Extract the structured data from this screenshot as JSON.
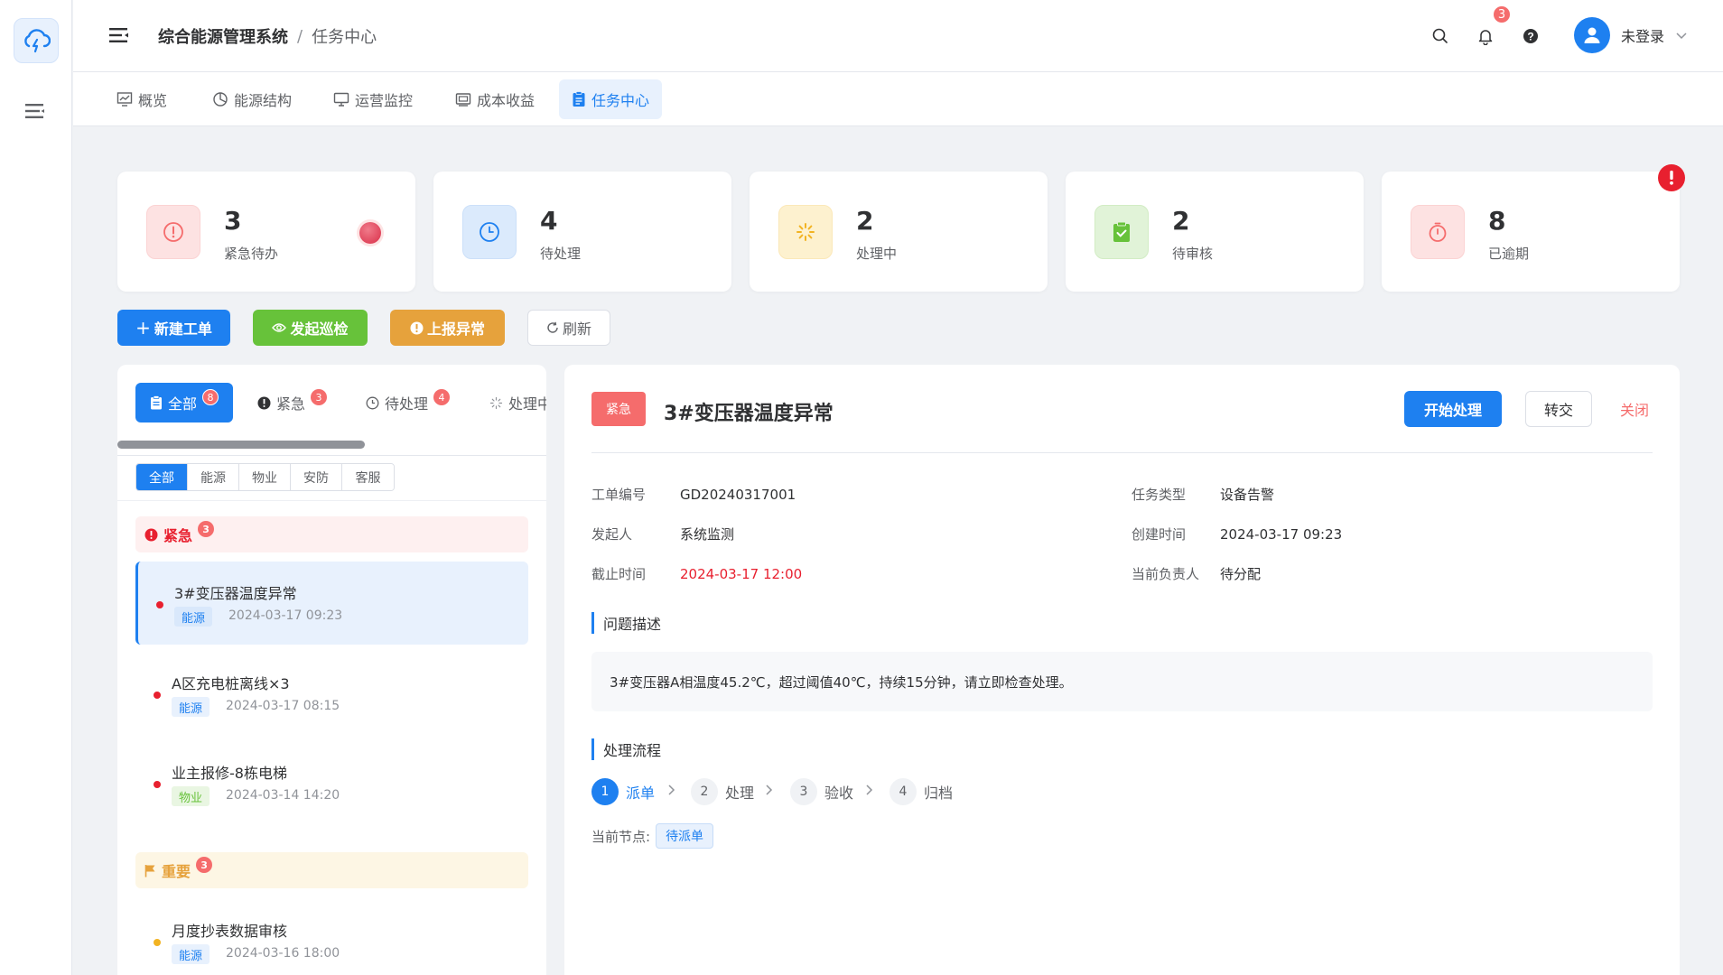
{
  "header": {
    "app_title": "综合能源管理系统",
    "separator": "/",
    "current_page": "任务中心",
    "notification_count": "3",
    "user_name": "未登录"
  },
  "tabs": [
    {
      "label": "概览",
      "icon": "chart-icon"
    },
    {
      "label": "能源结构",
      "icon": "pie-chart-icon"
    },
    {
      "label": "运营监控",
      "icon": "monitor-icon"
    },
    {
      "label": "成本收益",
      "icon": "money-icon"
    },
    {
      "label": "任务中心",
      "icon": "clipboard-icon",
      "active": true
    }
  ],
  "stats": [
    {
      "value": "3",
      "label": "紧急待办"
    },
    {
      "value": "4",
      "label": "待处理"
    },
    {
      "value": "2",
      "label": "处理中"
    },
    {
      "value": "2",
      "label": "待审核"
    },
    {
      "value": "8",
      "label": "已逾期"
    }
  ],
  "actions": {
    "new_order": "新建工单",
    "start_inspection": "发起巡检",
    "report_anomaly": "上报异常",
    "refresh": "刷新"
  },
  "list": {
    "status_tabs": [
      {
        "label": "全部",
        "count": "8"
      },
      {
        "label": "紧急",
        "count": "3"
      },
      {
        "label": "待处理",
        "count": "4"
      },
      {
        "label": "处理中",
        "count": ""
      }
    ],
    "categories": [
      "全部",
      "能源",
      "物业",
      "安防",
      "客服"
    ],
    "groups": [
      {
        "label": "紧急",
        "count": "3",
        "items": [
          {
            "title": "3#变压器温度异常",
            "tag": "能源",
            "time": "2024-03-17 09:23"
          },
          {
            "title": "A区充电桩离线×3",
            "tag": "能源",
            "time": "2024-03-17 08:15"
          },
          {
            "title": "业主报修-8栋电梯",
            "tag": "物业",
            "time": "2024-03-14 14:20"
          }
        ]
      },
      {
        "label": "重要",
        "count": "3",
        "items": [
          {
            "title": "月度抄表数据审核",
            "tag": "能源",
            "time": "2024-03-16 18:00"
          }
        ]
      }
    ]
  },
  "detail": {
    "priority": "紧急",
    "title": "3#变压器温度异常",
    "start_btn": "开始处理",
    "transfer_btn": "转交",
    "close_btn": "关闭",
    "fields": {
      "order_no_label": "工单编号",
      "order_no": "GD20240317001",
      "type_label": "任务类型",
      "type": "设备告警",
      "initiator_label": "发起人",
      "initiator": "系统监测",
      "created_label": "创建时间",
      "created": "2024-03-17 09:23",
      "deadline_label": "截止时间",
      "deadline": "2024-03-17 12:00",
      "owner_label": "当前负责人",
      "owner": "待分配"
    },
    "problem_title": "问题描述",
    "problem_text": "3#变压器A相温度45.2℃，超过阈值40℃，持续15分钟，请立即检查处理。",
    "flow_title": "处理流程",
    "steps": [
      {
        "n": "1",
        "label": "派单"
      },
      {
        "n": "2",
        "label": "处理"
      },
      {
        "n": "3",
        "label": "验收"
      },
      {
        "n": "4",
        "label": "归档"
      }
    ],
    "current_node_label": "当前节点:",
    "current_node": "待派单"
  },
  "colors": {
    "primary": "#1e80f0",
    "success": "#67c23a",
    "warning": "#e6a23c",
    "danger": "#f56c6c"
  }
}
